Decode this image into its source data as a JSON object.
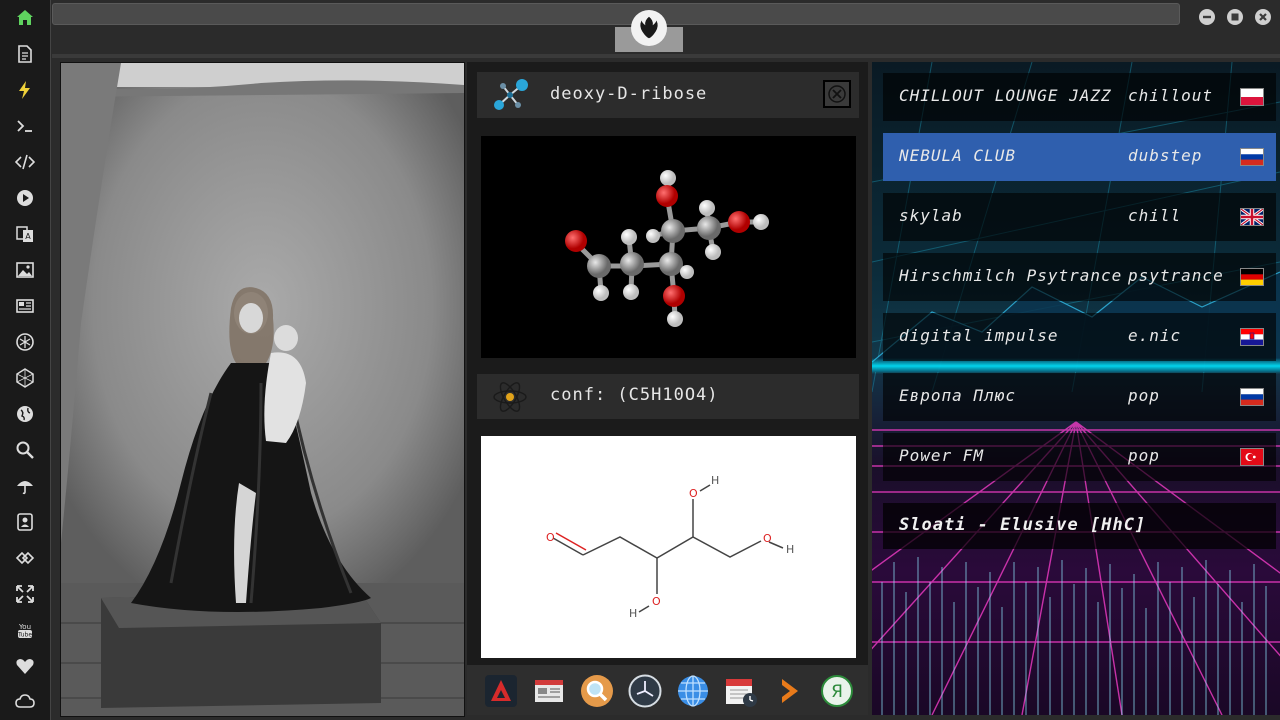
{
  "molecule": {
    "name": "deoxy-D-ribose",
    "conformer": "conf: (C5H10O4)",
    "atom_labels": {
      "o1": "O",
      "o2": "O",
      "h2": "H",
      "o3": "O",
      "h3": "H",
      "o4": "O",
      "h4": "H"
    }
  },
  "radio": {
    "stations": [
      {
        "name": "CHILLOUT LOUNGE JAZZ",
        "genre": "chillout",
        "flag": "poland",
        "active": false
      },
      {
        "name": "NEBULA CLUB",
        "genre": "dubstep",
        "flag": "russia",
        "active": true
      },
      {
        "name": "skylab",
        "genre": "chill",
        "flag": "uk",
        "active": false
      },
      {
        "name": "Hirschmilch Psytrance",
        "genre": "psytrance",
        "flag": "germany",
        "active": false
      },
      {
        "name": "digital impulse",
        "genre": "e.nic",
        "flag": "croatia",
        "active": false
      },
      {
        "name": "Европа Плюс",
        "genre": "pop",
        "flag": "russia",
        "active": false
      },
      {
        "name": "Power FM",
        "genre": "pop",
        "flag": "turkey",
        "active": false
      }
    ],
    "now_playing": "Sloati - Elusive [HhC]"
  },
  "sidebar": {
    "icons": [
      "home-icon",
      "document-icon",
      "lightning-icon",
      "terminal-icon",
      "code-icon",
      "play-icon",
      "translate-icon",
      "image-icon",
      "news-icon",
      "atom-icon",
      "hexagon-icon",
      "globe-icon",
      "search-icon",
      "umbrella-icon",
      "contact-icon",
      "link-icon",
      "fullscreen-icon",
      "youtube-icon",
      "heart-icon",
      "cloud-icon"
    ]
  },
  "dock": {
    "icons": [
      "arch-icon",
      "news-app-icon",
      "search-app-icon",
      "clock-icon",
      "browser-icon",
      "calendar-icon",
      "arrow-icon",
      "yandex-icon"
    ],
    "yandex_label": "Я"
  },
  "colors": {
    "accent_green": "#5fd35f",
    "active_row": "#2f5fae",
    "oxygen": "#e01818"
  }
}
